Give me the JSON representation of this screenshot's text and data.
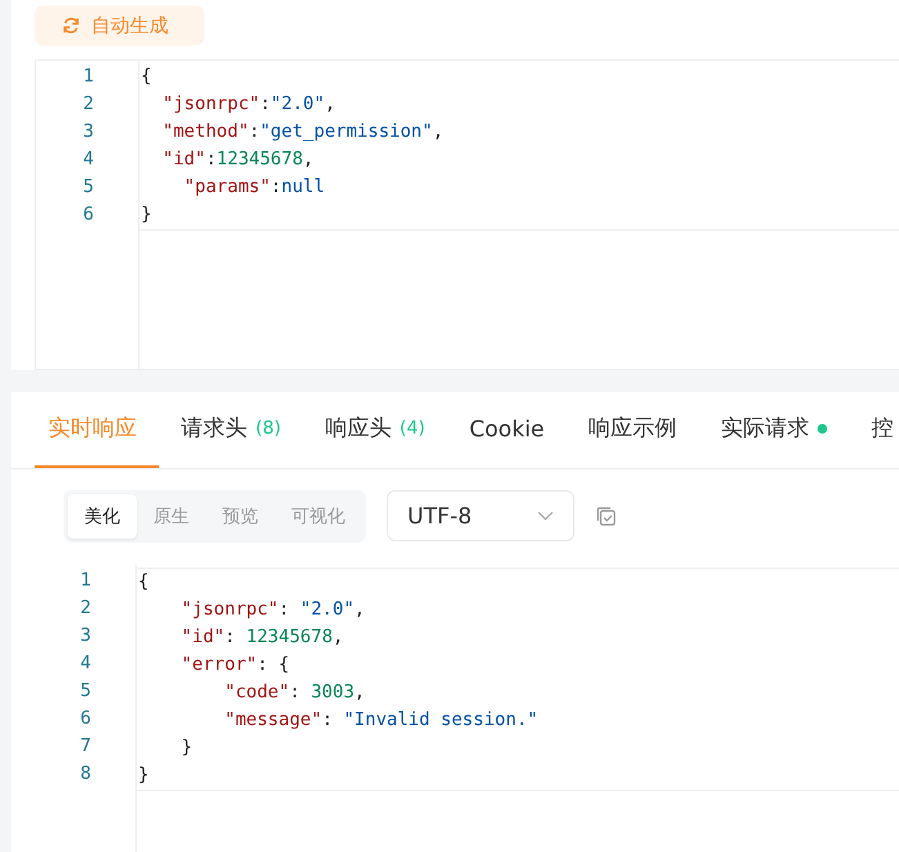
{
  "generate_button": {
    "label": "自动生成"
  },
  "request_editor": {
    "lines": [
      {
        "number": "1",
        "tokens": [
          {
            "kind": "punct",
            "text": "{"
          }
        ]
      },
      {
        "number": "2",
        "tokens": [
          {
            "kind": "key",
            "text": "  \"jsonrpc\""
          },
          {
            "kind": "punct",
            "text": ":"
          },
          {
            "kind": "string",
            "text": "\"2.0\""
          },
          {
            "kind": "punct",
            "text": ","
          }
        ]
      },
      {
        "number": "3",
        "tokens": [
          {
            "kind": "key",
            "text": "  \"method\""
          },
          {
            "kind": "punct",
            "text": ":"
          },
          {
            "kind": "string",
            "text": "\"get_permission\""
          },
          {
            "kind": "punct",
            "text": ","
          }
        ]
      },
      {
        "number": "4",
        "tokens": [
          {
            "kind": "key",
            "text": "  \"id\""
          },
          {
            "kind": "punct",
            "text": ":"
          },
          {
            "kind": "number",
            "text": "12345678"
          },
          {
            "kind": "punct",
            "text": ","
          }
        ]
      },
      {
        "number": "5",
        "tokens": [
          {
            "kind": "key",
            "text": "    \"params\""
          },
          {
            "kind": "punct",
            "text": ":"
          },
          {
            "kind": "keyword",
            "text": "null"
          }
        ]
      },
      {
        "number": "6",
        "tokens": [
          {
            "kind": "punct",
            "text": "}"
          }
        ]
      }
    ]
  },
  "tabs": [
    {
      "label": "实时响应",
      "selected": true
    },
    {
      "label": "请求头",
      "count": "(8)",
      "selected": false
    },
    {
      "label": "响应头",
      "count": "(4)",
      "selected": false
    },
    {
      "label": "Cookie",
      "selected": false
    },
    {
      "label": "响应示例",
      "selected": false
    },
    {
      "label": "实际请求",
      "color": "#1cc88a",
      "selected": false
    },
    {
      "label": "控",
      "selected": false
    }
  ],
  "view_modes": [
    {
      "label": "美化",
      "selected": true
    },
    {
      "label": "原生",
      "selected": false
    },
    {
      "label": "预览",
      "selected": false
    },
    {
      "label": "可视化",
      "selected": false
    }
  ],
  "encoding_select": {
    "value": "UTF-8"
  },
  "response_editor": {
    "lines": [
      {
        "number": "1",
        "tokens": [
          {
            "kind": "punct",
            "text": "{"
          }
        ]
      },
      {
        "number": "2",
        "tokens": [
          {
            "kind": "key",
            "text": "    \"jsonrpc\""
          },
          {
            "kind": "punct",
            "text": ": "
          },
          {
            "kind": "string",
            "text": "\"2.0\""
          },
          {
            "kind": "punct",
            "text": ","
          }
        ]
      },
      {
        "number": "3",
        "tokens": [
          {
            "kind": "key",
            "text": "    \"id\""
          },
          {
            "kind": "punct",
            "text": ": "
          },
          {
            "kind": "number",
            "text": "12345678"
          },
          {
            "kind": "punct",
            "text": ","
          }
        ]
      },
      {
        "number": "4",
        "tokens": [
          {
            "kind": "key",
            "text": "    \"error\""
          },
          {
            "kind": "punct",
            "text": ": {"
          }
        ]
      },
      {
        "number": "5",
        "tokens": [
          {
            "kind": "key",
            "text": "        \"code\""
          },
          {
            "kind": "punct",
            "text": ": "
          },
          {
            "kind": "number",
            "text": "3003"
          },
          {
            "kind": "punct",
            "text": ","
          }
        ]
      },
      {
        "number": "6",
        "tokens": [
          {
            "kind": "key",
            "text": "        \"message\""
          },
          {
            "kind": "punct",
            "text": ": "
          },
          {
            "kind": "string",
            "text": "\"Invalid session.\""
          }
        ]
      },
      {
        "number": "7",
        "tokens": [
          {
            "kind": "punct",
            "text": "    }"
          }
        ]
      },
      {
        "number": "8",
        "tokens": [
          {
            "kind": "punct",
            "text": "}"
          }
        ]
      }
    ]
  }
}
